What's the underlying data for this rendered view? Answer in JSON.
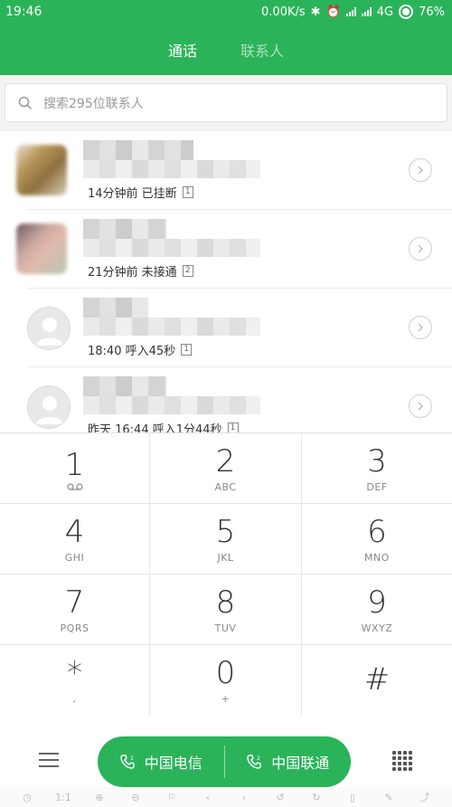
{
  "status_bar": {
    "time": "19:46",
    "speed": "0.00K/s",
    "network": "4G",
    "battery": "76%"
  },
  "tabs": [
    {
      "label": "通话",
      "active": true
    },
    {
      "label": "联系人",
      "active": false
    }
  ],
  "search": {
    "placeholder": "搜索295位联系人"
  },
  "call_log": [
    {
      "subtitle": "14分钟前 已挂断",
      "sim": "1"
    },
    {
      "subtitle": "21分钟前 未接通",
      "sim": "2"
    },
    {
      "subtitle": "18:40 呼入45秒",
      "sim": "1"
    },
    {
      "subtitle": "昨天 16:44 呼入1分44秒",
      "sim": "1"
    }
  ],
  "keypad": [
    {
      "num": "1",
      "letters": ""
    },
    {
      "num": "2",
      "letters": "ABC"
    },
    {
      "num": "3",
      "letters": "DEF"
    },
    {
      "num": "4",
      "letters": "GHI"
    },
    {
      "num": "5",
      "letters": "JKL"
    },
    {
      "num": "6",
      "letters": "MNO"
    },
    {
      "num": "7",
      "letters": "PQRS"
    },
    {
      "num": "8",
      "letters": "TUV"
    },
    {
      "num": "9",
      "letters": "WXYZ"
    },
    {
      "num": "*",
      "letters": ","
    },
    {
      "num": "0",
      "letters": "+"
    },
    {
      "num": "#",
      "letters": ""
    }
  ],
  "call_buttons": {
    "sim1_label": "中国电信",
    "sim2_label": "中国联通"
  },
  "toolbar": {
    "zoom_ratio": "1:1"
  },
  "colors": {
    "accent": "#2bb35a"
  }
}
